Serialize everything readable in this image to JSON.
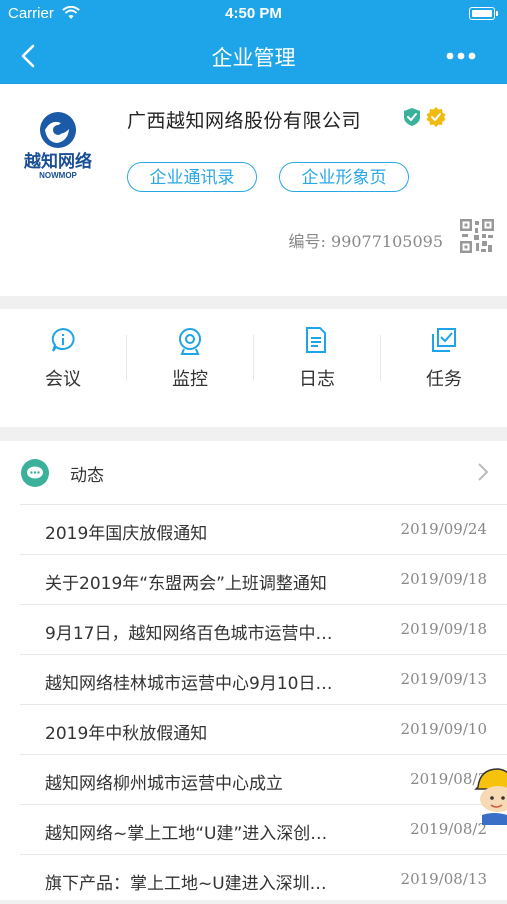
{
  "status_bar": {
    "carrier": "Carrier",
    "time": "4:50 PM"
  },
  "nav": {
    "title": "企业管理"
  },
  "company": {
    "logo_text": "越知网络",
    "logo_subtext": "NOWMOP",
    "name": "广西越知网络股份有限公司",
    "buttons": [
      "企业通讯录",
      "企业形象页"
    ],
    "code_label": "编号:",
    "code_value": "99077105095"
  },
  "quick_actions": [
    {
      "label": "会议",
      "icon": "meeting-icon"
    },
    {
      "label": "监控",
      "icon": "camera-icon"
    },
    {
      "label": "日志",
      "icon": "log-icon"
    },
    {
      "label": "任务",
      "icon": "task-icon"
    }
  ],
  "feed": {
    "title": "动态",
    "items": [
      {
        "title": "2019年国庆放假通知",
        "date": "2019/09/24"
      },
      {
        "title": "关于2019年“东盟两会”上班调整通知",
        "date": "2019/09/18"
      },
      {
        "title": "9月17日，越知网络百色城市运营中…",
        "date": "2019/09/18"
      },
      {
        "title": "越知网络桂林城市运营中心9月10日…",
        "date": "2019/09/13"
      },
      {
        "title": "2019年中秋放假通知",
        "date": "2019/09/10"
      },
      {
        "title": "越知网络柳州城市运营中心成立",
        "date": "2019/08/3"
      },
      {
        "title": "越知网络~掌上工地“U建”进入深创…",
        "date": "2019/08/2"
      },
      {
        "title": "旗下产品：掌上工地~U建进入深圳…",
        "date": "2019/08/13"
      }
    ]
  },
  "colors": {
    "primary": "#1ea4e9",
    "accent": "#2aa8e6",
    "badge_teal": "#3bb19b",
    "badge_gold": "#f2b90f"
  }
}
